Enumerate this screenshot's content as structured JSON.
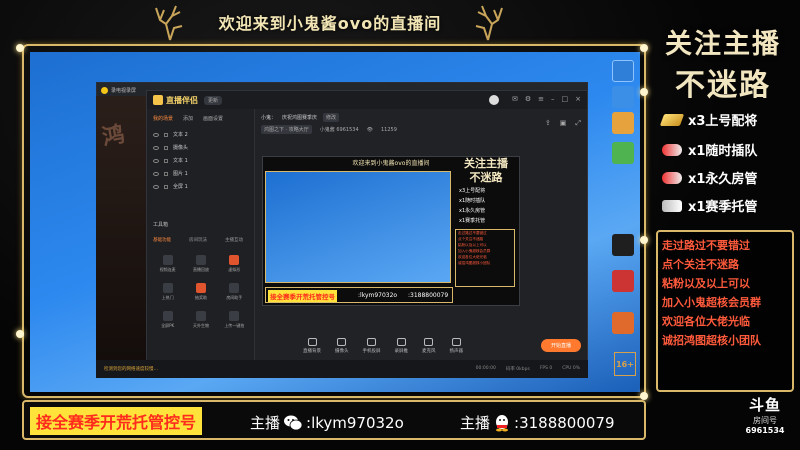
{
  "overlay": {
    "title": "欢迎来到小鬼酱ovo的直播间",
    "follow_line1": "关注主播",
    "follow_line2": "不迷路",
    "perks": [
      {
        "label": "x3上号配将",
        "icon": "gold-bar-icon",
        "color": "#f3c244"
      },
      {
        "label": "x1随时插队",
        "icon": "rocket-icon",
        "color": "#e8e8e8"
      },
      {
        "label": "x1永久房管",
        "icon": "rocket-icon",
        "color": "#e8e8e8"
      },
      {
        "label": "x1赛季托管",
        "icon": "plane-icon",
        "color": "#e8e8e8"
      }
    ],
    "notice_lines": [
      "走过路过不要错过",
      "点个关注不迷路",
      "粘粉以及以上可以",
      "加入小鬼超核会员群",
      "欢迎各位大佬光临",
      "诚招鸿图超核小团队"
    ],
    "promo": "接全赛季开荒托管控号",
    "wechat_label": "主播",
    "wechat_id": ":lkym97032o",
    "qq_label": "主播",
    "qq_id": ":3188800079"
  },
  "douyu": {
    "logo": "斗鱼",
    "room_label": "房间号",
    "room_id": "6961534"
  },
  "recorder": {
    "title": "录电视录屏"
  },
  "app": {
    "name": "直播伴侣",
    "version": "更新",
    "left_tabs": [
      "我的场景",
      "添加",
      "画面设置"
    ],
    "scenes": [
      "文本 2",
      "摄像头",
      "文本 1",
      "图片 1",
      "全屏 1"
    ],
    "tools_title": "工具箱",
    "tools_tabs": [
      "基础功能",
      "房间玩法",
      "主播互动"
    ],
    "tools": [
      {
        "label": "视频连麦",
        "hot": false
      },
      {
        "label": "直播回放",
        "hot": false
      },
      {
        "label": "虚拟形",
        "hot": true
      },
      {
        "label": "上热门",
        "hot": false
      },
      {
        "label": "抽奖助",
        "hot": true
      },
      {
        "label": "房间助手",
        "hot": false
      },
      {
        "label": "全屏PK",
        "hot": false
      },
      {
        "label": "天外生物",
        "hot": false
      },
      {
        "label": "上传一键拍",
        "hot": false
      }
    ],
    "room_name_label": "小鬼：",
    "room_name": "庆祝鸿图赛季庆",
    "room_edit": "修改",
    "category": "鸿图之下 · 攻略大厅",
    "room_id": "小鬼酱 6961534",
    "viewers": "11259",
    "bottom_tools": [
      "直播背景",
      "摄像头",
      "手机投屏",
      "录屏推",
      "麦克风",
      "扬声器"
    ],
    "start_button": "开始直播"
  },
  "taskbar": {
    "warning": "检测到您的网络速度较慢…",
    "stats": [
      "00:00:00",
      "码率 0kbps",
      "FPS 0",
      "CPU 0%"
    ]
  },
  "age_rating": "16+"
}
